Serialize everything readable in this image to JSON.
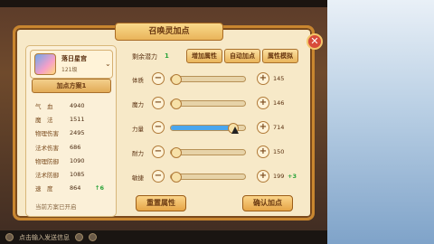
{
  "dialog": {
    "title": "召唤灵加点",
    "close_label": "✕"
  },
  "pet": {
    "name": "落日星宫",
    "level": "121级"
  },
  "plan": {
    "button_label": "加点方案1",
    "status": "当前方案已开启"
  },
  "stats": [
    {
      "label": "气　血",
      "value": "4940",
      "bonus": ""
    },
    {
      "label": "魔　法",
      "value": "1511",
      "bonus": ""
    },
    {
      "label": "物理伤害",
      "value": "2495",
      "bonus": ""
    },
    {
      "label": "法术伤害",
      "value": "686",
      "bonus": ""
    },
    {
      "label": "物理防御",
      "value": "1090",
      "bonus": ""
    },
    {
      "label": "法术防御",
      "value": "1085",
      "bonus": ""
    },
    {
      "label": "速　度",
      "value": "864",
      "bonus": "↑6"
    }
  ],
  "potential": {
    "label": "剩余潜力",
    "value": "1"
  },
  "top_buttons": {
    "add": "增加属性",
    "auto": "自动加点",
    "simulate": "属性模拟"
  },
  "attributes": [
    {
      "label": "体质",
      "value": "145",
      "bonus": "",
      "fill": 0.0
    },
    {
      "label": "魔力",
      "value": "146",
      "bonus": "",
      "fill": 0.0
    },
    {
      "label": "力量",
      "value": "714",
      "bonus": "",
      "fill": 0.82
    },
    {
      "label": "耐力",
      "value": "150",
      "bonus": "",
      "fill": 0.0
    },
    {
      "label": "敏捷",
      "value": "199",
      "bonus": "+3",
      "fill": 0.0
    }
  ],
  "bottom_buttons": {
    "reset": "重置属性",
    "confirm": "确认加点"
  },
  "chat": {
    "hint": "点击输入发送信息"
  },
  "colors": {
    "accent": "#e9b45a",
    "bar_fill": "#4aa6ee",
    "bonus": "#2aa33a"
  }
}
